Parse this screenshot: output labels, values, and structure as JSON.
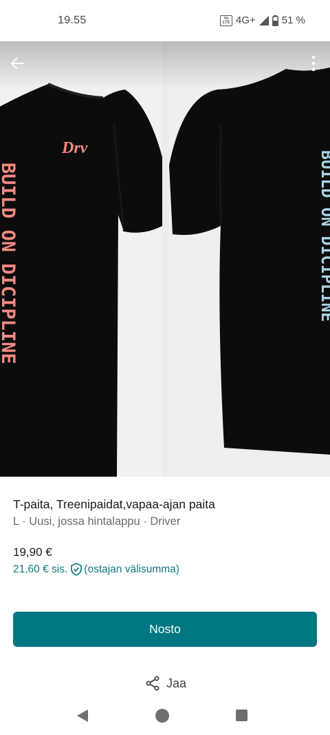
{
  "status_bar": {
    "time": "19.55",
    "volte_label": "Vo LTE",
    "network": "4G+",
    "battery": "51 %"
  },
  "gallery": {
    "photo_1": {
      "logo_text": "Drv",
      "vertical_text": "BUILD ON DICIPLINE",
      "text_color": "#f08a82"
    },
    "photo_2": {
      "vertical_text": "BUILD ON DICIPLINE",
      "text_color": "#a9d3e6"
    },
    "shirt_color": "#0c0c0c"
  },
  "product": {
    "title": "T-paita, Treenipaidat,vapaa-ajan paita",
    "subtitle": "L · Uusi, jossa hintalappu · Driver",
    "price": "19,90 €",
    "price_incl": "21,60 €  sis.",
    "buyer_protection": "(ostajan välisumma)"
  },
  "actions": {
    "buy_label": "Nosto",
    "share_label": "Jaa"
  },
  "colors": {
    "accent": "#017782",
    "accent_text": "#107a80"
  }
}
